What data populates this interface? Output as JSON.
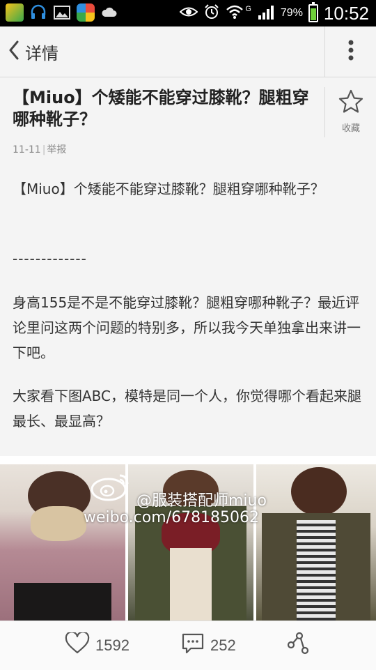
{
  "status_bar": {
    "battery_percent": "79%",
    "battery_level": 0.79,
    "network": "G",
    "time": "10:52"
  },
  "header": {
    "back_label": "详情"
  },
  "article": {
    "title": "【Miuo】个矮能不能穿过膝靴？腿粗穿哪种靴子？",
    "favorite_label": "收藏",
    "date": "11-11",
    "report_label": "举报",
    "paragraphs": [
      "【Miuo】个矮能不能穿过膝靴？腿粗穿哪种靴子？",
      "-------------",
      "身高155是不是不能穿过膝靴？腿粗穿哪种靴子？最近评论里问这两个问题的特别多，所以我今天单独拿出来讲一下吧。",
      "大家看下图ABC，模特是同一个人，你觉得哪个看起来腿最长、最显高？"
    ]
  },
  "image": {
    "watermark_name": "@服装搭配师miuo",
    "watermark_url": "weibo.com/678185062"
  },
  "bottom_bar": {
    "likes": "1592",
    "comments": "252"
  },
  "icons": {
    "back": "chevron-left-icon",
    "more": "more-vertical-icon",
    "favorite": "star-icon",
    "like": "heart-icon",
    "comment": "comment-icon",
    "share": "share-icon"
  },
  "colors": {
    "battery": "#6fd13a",
    "background": "#f4f4f4"
  }
}
